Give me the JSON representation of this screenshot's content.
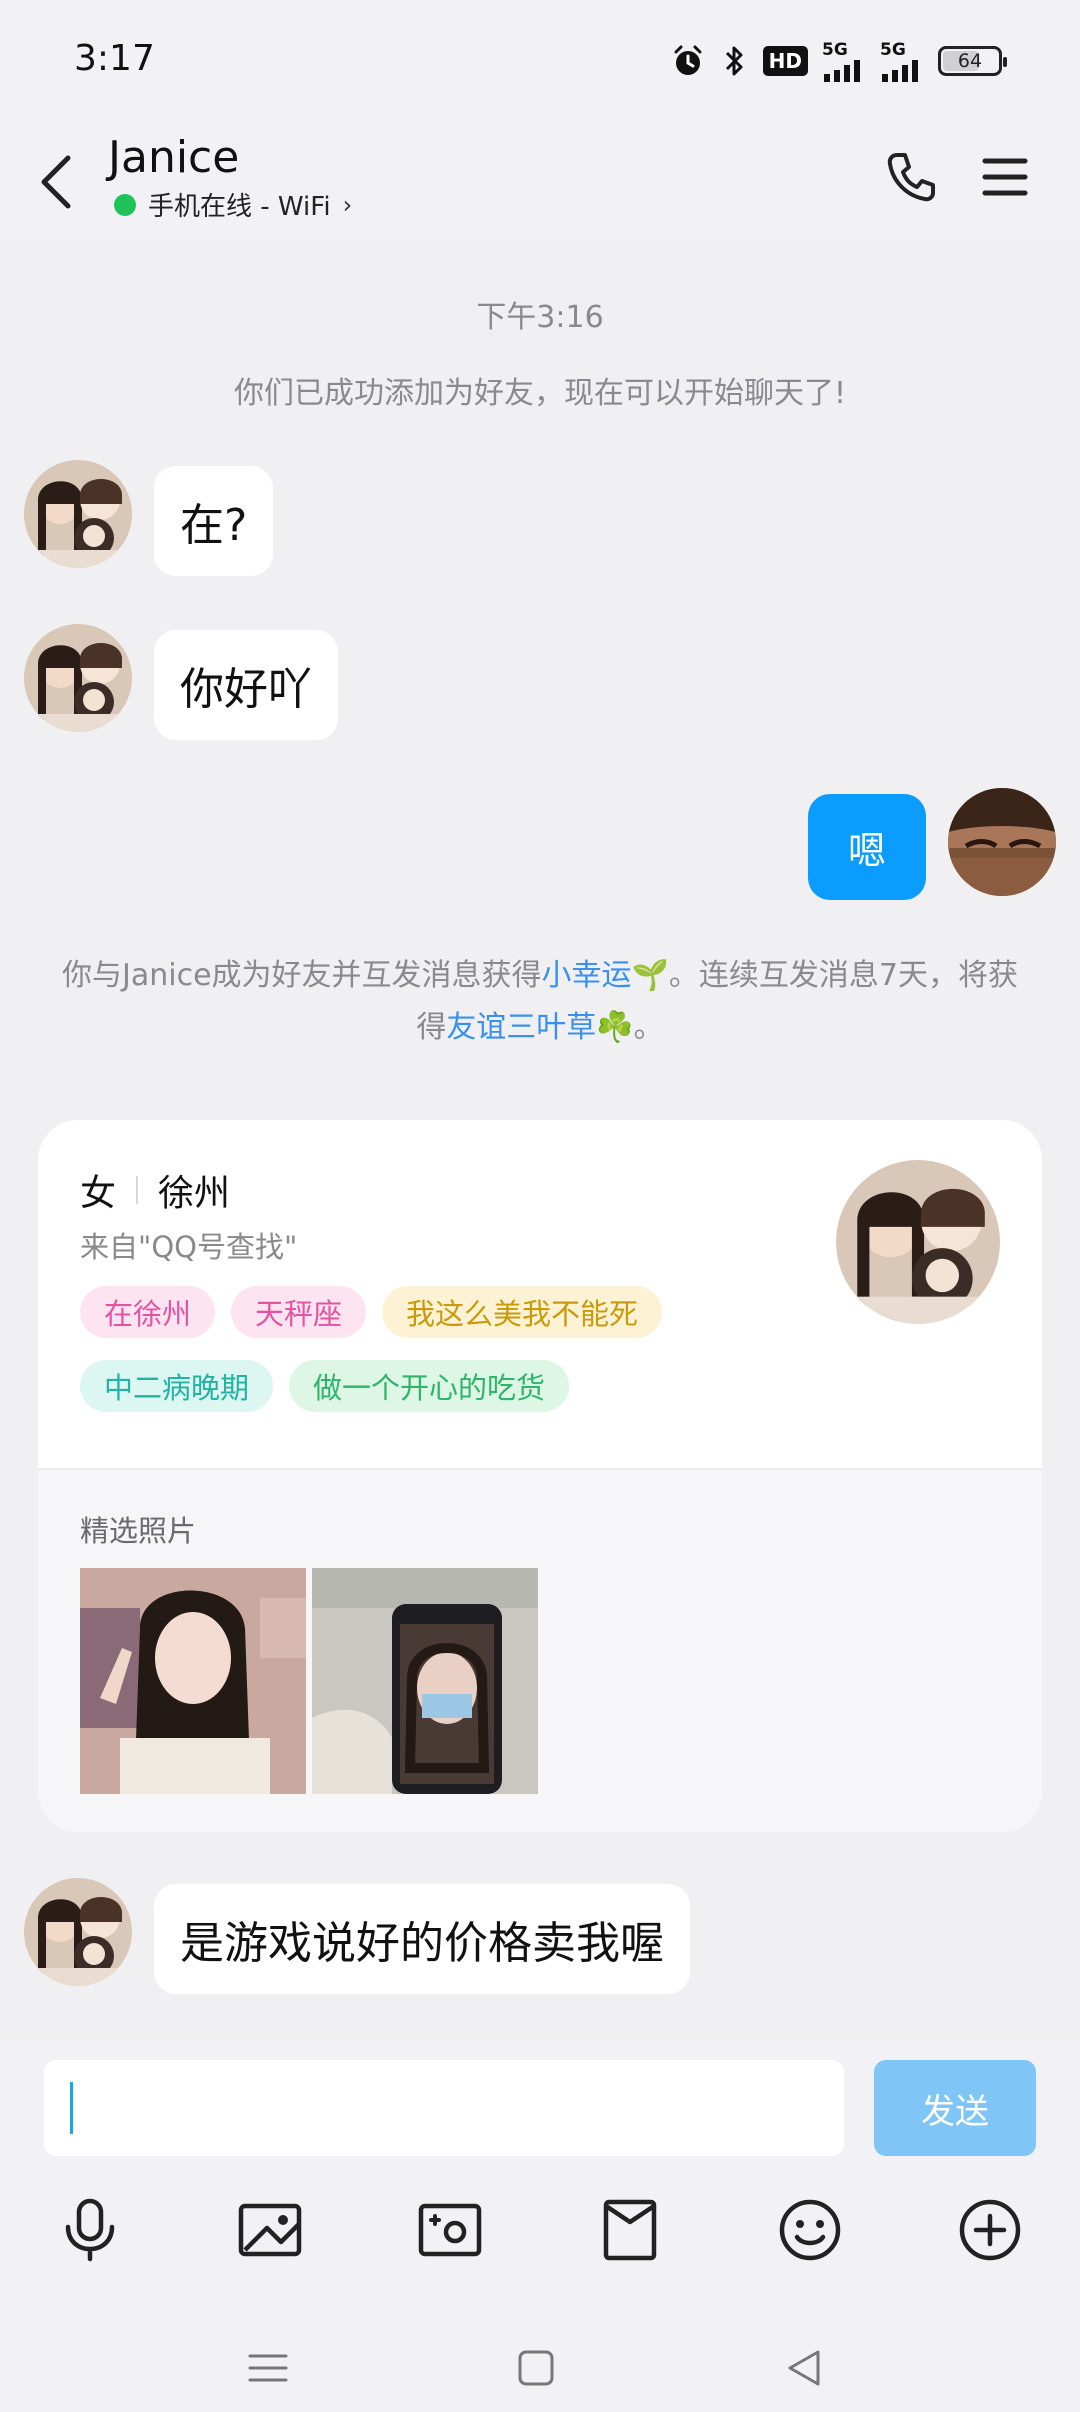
{
  "status_bar": {
    "time": "3:17",
    "hd_label": "HD",
    "signal_1_label": "5G",
    "signal_2_label": "5G",
    "battery_level": "64"
  },
  "header": {
    "contact_name": "Janice",
    "status_text": "手机在线 - WiFi",
    "chevron": "›"
  },
  "chat": {
    "timestamp": "下午3:16",
    "system_message": "你们已成功添加为好友，现在可以开始聊天了!",
    "messages": [
      {
        "from": "other",
        "text": "在?"
      },
      {
        "from": "other",
        "text": "你好吖"
      },
      {
        "from": "self",
        "text": "嗯"
      },
      {
        "from": "other",
        "text": "是游戏说好的价格卖我喔"
      }
    ],
    "friend_note": {
      "part1": "你与Janice成为好友并互发消息获得",
      "link1": "小幸运",
      "emoji1": "🌱",
      "part2": "。连续互发消息7天，将获得",
      "link2": "友谊三叶草",
      "emoji2": "☘️",
      "part3": "。"
    }
  },
  "profile_card": {
    "gender": "女",
    "city": "徐州",
    "source": "来自\"QQ号查找\"",
    "tags_row1": [
      "在徐州",
      "天秤座",
      "我这么美我不能死"
    ],
    "tags_row2": [
      "中二病晚期",
      "做一个开心的吃货"
    ],
    "photos_title": "精选照片"
  },
  "input": {
    "placeholder": "",
    "send_label": "发送"
  },
  "toolbar_icons": [
    "microphone-icon",
    "image-icon",
    "camera-icon",
    "red-packet-icon",
    "emoji-icon",
    "plus-icon"
  ],
  "nav_icons": [
    "menu-icon",
    "home-icon",
    "back-icon"
  ],
  "colors": {
    "accent": "#0a9cff",
    "send_button_disabled": "#7fc6f7",
    "online": "#20c35a",
    "link": "#3a8ff0"
  }
}
